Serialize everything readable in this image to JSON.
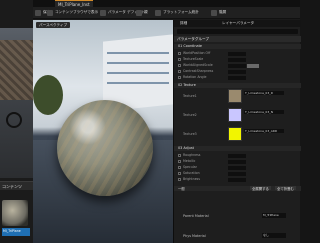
{
  "left": {
    "content_browser_tab": "コンテンツ",
    "asset_label": "MI_TriPlane"
  },
  "window": {
    "tab_title": "MI_TriPlane_Inst",
    "toolbar": [
      "保存",
      "コンテンツブラウザで表示",
      "パラメータ デフォルト",
      "親",
      "プラットフォーム統計",
      "階層"
    ]
  },
  "viewport": {
    "tab_label": "パースペクティブ"
  },
  "details": {
    "tab_details": "詳細",
    "tab_layers": "レイヤーパラメータ",
    "category_bar": "パラメータグループ",
    "groups": {
      "g1": "01 Coordinate",
      "g2": "02 Texture",
      "g3": "03 Adjust",
      "g4": "一般"
    },
    "coordinate_rows": [
      "WorldPosition Off",
      "TextureScale",
      "WorldAlignedScale",
      "ContrastSharpness",
      "Rotation Angle"
    ],
    "textures": [
      {
        "label": "Texture1",
        "name": "T_Limestone_03_D",
        "color": "#9a8a6e"
      },
      {
        "label": "Texture2",
        "name": "T_Limestone_03_N",
        "color": "#c9c6ff"
      },
      {
        "label": "Texture3",
        "name": "T_Limestone_03_ARD",
        "color": "#f2f500"
      }
    ],
    "adjust_rows": [
      "Roughness",
      "Metallic",
      "Specular",
      "Saturation",
      "Brightness"
    ],
    "adjust_buttons": [
      "全展開する",
      "全て折畳む"
    ],
    "parent_label": "Parent Material",
    "parent_value": "M_TriPlane",
    "physical_label": "Phys Material",
    "physical_value": "なし"
  }
}
